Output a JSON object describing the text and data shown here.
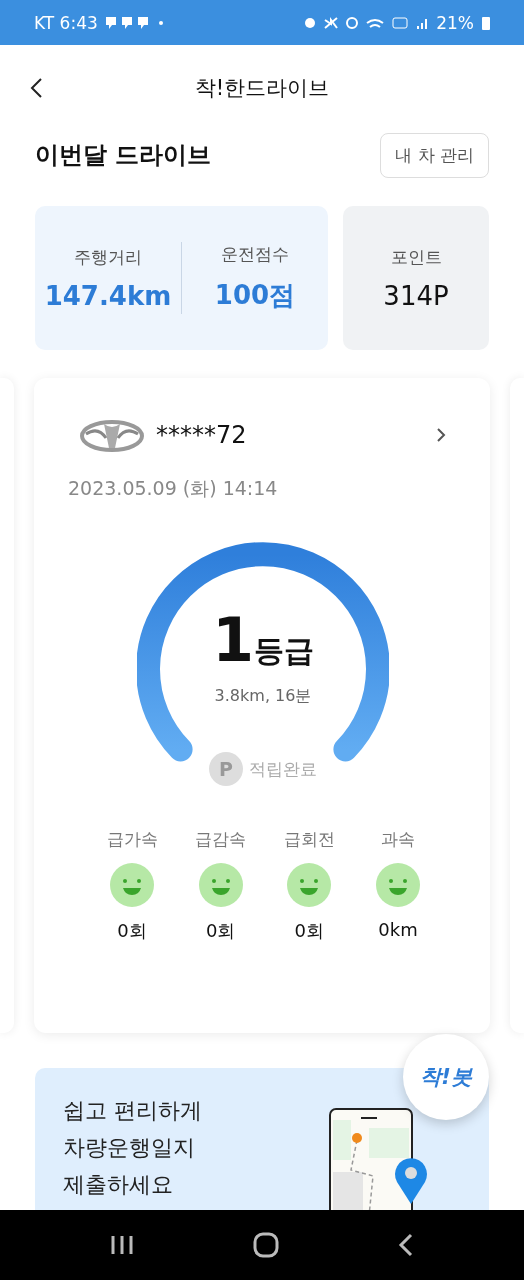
{
  "status_bar": {
    "carrier_time": "KT 6:43",
    "battery": "21%"
  },
  "header": {
    "title": "착!한드라이브"
  },
  "section": {
    "title": "이번달 드라이브",
    "button": "내 차 관리"
  },
  "stats": [
    {
      "label": "주행거리",
      "value": "147.4km"
    },
    {
      "label": "운전점수",
      "value": "100점"
    }
  ],
  "points": {
    "label": "포인트",
    "value": "314P"
  },
  "trip": {
    "plate": "*****72",
    "datetime": "2023.05.09 (화) 14:14",
    "grade_number": "1",
    "grade_unit": "등급",
    "summary": "3.8km, 16분",
    "point_badge": "P",
    "point_status": "적립완료",
    "events": [
      {
        "label": "급가속",
        "value": "0회"
      },
      {
        "label": "급감속",
        "value": "0회"
      },
      {
        "label": "급회전",
        "value": "0회"
      },
      {
        "label": "과속",
        "value": "0km"
      }
    ]
  },
  "banner": {
    "lines": [
      "쉽고 편리하게",
      "차량운행일지",
      "제출하세요"
    ],
    "bot": "착!봇"
  }
}
